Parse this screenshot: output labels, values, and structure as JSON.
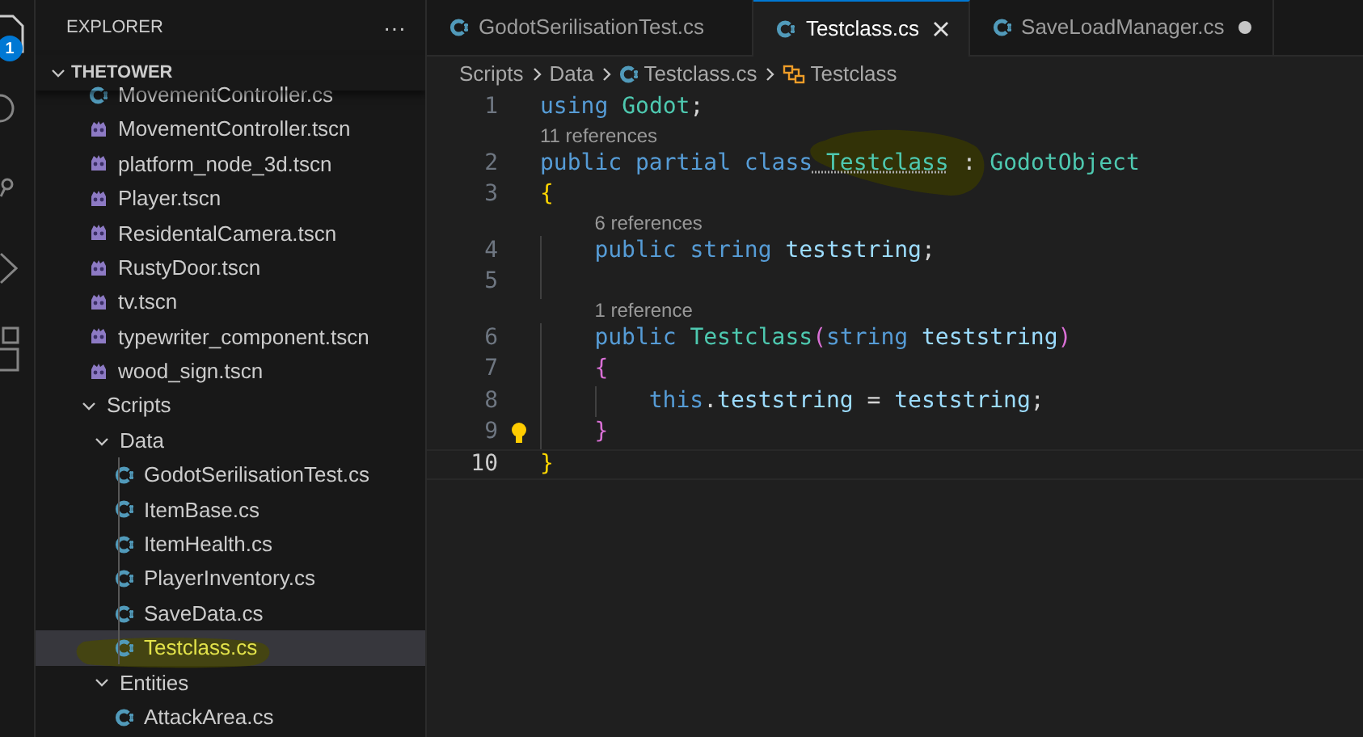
{
  "activity_bar": {
    "badge": "1"
  },
  "sidebar": {
    "title": "EXPLORER",
    "more": "···",
    "root": {
      "label": "THETOWER",
      "expanded": true
    },
    "items": [
      {
        "label": "MovementController.cs",
        "kind": "csharp",
        "selected": false
      },
      {
        "label": "MovementController.tscn",
        "kind": "scene",
        "selected": false
      },
      {
        "label": "platform_node_3d.tscn",
        "kind": "scene",
        "selected": false
      },
      {
        "label": "Player.tscn",
        "kind": "scene",
        "selected": false
      },
      {
        "label": "ResidentalCamera.tscn",
        "kind": "scene",
        "selected": false
      },
      {
        "label": "RustyDoor.tscn",
        "kind": "scene",
        "selected": false
      },
      {
        "label": "tv.tscn",
        "kind": "scene",
        "selected": false
      },
      {
        "label": "typewriter_component.tscn",
        "kind": "scene",
        "selected": false
      },
      {
        "label": "wood_sign.tscn",
        "kind": "scene",
        "selected": false
      },
      {
        "label": "Scripts",
        "kind": "folder",
        "expanded": true,
        "selected": false,
        "children": [
          {
            "label": "Data",
            "kind": "folder",
            "expanded": true,
            "selected": false,
            "children": [
              {
                "label": "GodotSerilisationTest.cs",
                "kind": "csharp",
                "selected": false
              },
              {
                "label": "ItemBase.cs",
                "kind": "csharp",
                "selected": false
              },
              {
                "label": "ItemHealth.cs",
                "kind": "csharp",
                "selected": false
              },
              {
                "label": "PlayerInventory.cs",
                "kind": "csharp",
                "selected": false
              },
              {
                "label": "SaveData.cs",
                "kind": "csharp",
                "selected": false
              },
              {
                "label": "Testclass.cs",
                "kind": "csharp",
                "selected": true
              }
            ]
          },
          {
            "label": "Entities",
            "kind": "folder",
            "expanded": true,
            "selected": false,
            "children": [
              {
                "label": "AttackArea.cs",
                "kind": "csharp",
                "selected": false
              }
            ]
          }
        ]
      }
    ]
  },
  "tabs": [
    {
      "label": "GodotSerilisationTest.cs",
      "selected": false,
      "modified": false
    },
    {
      "label": "Testclass.cs",
      "selected": true,
      "modified": false
    },
    {
      "label": "SaveLoadManager.cs",
      "selected": false,
      "modified": true
    }
  ],
  "breadcrumb": [
    {
      "label": "Scripts",
      "kind": "folder"
    },
    {
      "label": "Data",
      "kind": "folder"
    },
    {
      "label": "Testclass.cs",
      "kind": "csharp"
    },
    {
      "label": "Testclass",
      "kind": "class"
    }
  ],
  "code": [
    {
      "number": "1",
      "current": false,
      "tokens": [
        {
          "text": "using",
          "kind": "keyword"
        },
        {
          "text": " Godot",
          "kind": "type"
        },
        {
          "text": ";",
          "kind": "plain"
        }
      ]
    },
    {
      "number": "2",
      "current": false,
      "codelens": "11 references",
      "tokens": [
        {
          "text": "public partial class",
          "kind": "keyword"
        },
        {
          "text": " Testclass",
          "kind": "type",
          "hint": true
        },
        {
          "text": " : ",
          "kind": "plain"
        },
        {
          "text": "GodotObject",
          "kind": "type"
        }
      ]
    },
    {
      "number": "3",
      "current": false,
      "tokens": [
        {
          "text": "{",
          "kind": "brace1"
        }
      ],
      "children": [
        {
          "number": "4",
          "current": false,
          "codelens": "6 references",
          "tokens": [
            {
              "text": "public string",
              "kind": "keyword"
            },
            {
              "text": " teststring",
              "kind": "variable"
            },
            {
              "text": ";",
              "kind": "plain"
            }
          ]
        },
        {
          "number": "5",
          "current": false
        },
        {
          "number": "6",
          "current": false,
          "codelens": "1 reference",
          "tokens": [
            {
              "text": "public",
              "kind": "keyword"
            },
            {
              "text": " Testclass",
              "kind": "type"
            },
            {
              "text": "(",
              "kind": "brace2"
            },
            {
              "text": "string",
              "kind": "keyword"
            },
            {
              "text": " teststring",
              "kind": "variable"
            },
            {
              "text": ")",
              "kind": "brace2"
            }
          ]
        },
        {
          "number": "7",
          "current": false,
          "tokens": [
            {
              "text": "{",
              "kind": "brace2"
            }
          ],
          "children": [
            {
              "number": "8",
              "current": false,
              "tokens": [
                {
                  "text": "this",
                  "kind": "keyword"
                },
                {
                  "text": ".",
                  "kind": "plain"
                },
                {
                  "text": "teststring",
                  "kind": "variable"
                },
                {
                  "text": " = ",
                  "kind": "plain"
                },
                {
                  "text": "teststring",
                  "kind": "variable"
                },
                {
                  "text": ";",
                  "kind": "plain"
                }
              ]
            }
          ]
        },
        {
          "number": "9",
          "current": false,
          "lightbulb": true,
          "tokens": [
            {
              "text": "}",
              "kind": "brace2"
            }
          ]
        }
      ]
    },
    {
      "number": "10",
      "current": true,
      "tokens": [
        {
          "text": "}",
          "kind": "brace1"
        }
      ]
    }
  ]
}
